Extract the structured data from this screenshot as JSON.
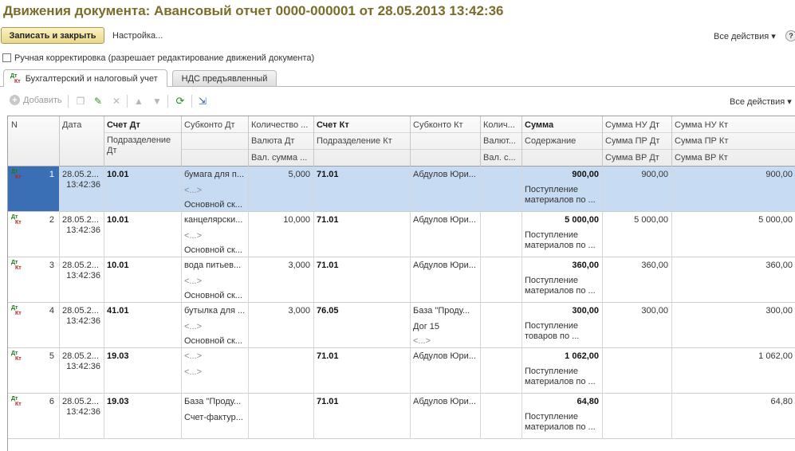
{
  "window": {
    "title": "Движения документа: Авансовый отчет 0000-000001 от 28.05.2013 13:42:36"
  },
  "toolbar": {
    "save_close": "Записать и закрыть",
    "settings": "Настройка...",
    "all_actions": "Все действия ▾",
    "help": "?"
  },
  "manual_correction": {
    "label": "Ручная корректировка (разрешает редактирование движений документа)",
    "checked": false
  },
  "tabs": [
    {
      "icon_top": "Дт",
      "icon_bottom": "Кт",
      "label": "Бухгалтерский и налоговый учет",
      "active": true
    },
    {
      "label": "НДС предъявленный",
      "active": false
    }
  ],
  "table_toolbar": {
    "add": "Добавить",
    "all_actions": "Все действия ▾"
  },
  "table": {
    "headers": {
      "n": "N",
      "date": "Дата",
      "acc_dt": "Счет Дт",
      "sub_dt": "Субконто Дт",
      "qty_dt": "Количество ...",
      "acc_kt": "Счет Кт",
      "sub_kt": "Субконто Кт",
      "qty_kt": "Колич...",
      "sum": "Сумма",
      "sum_nu_dt": "Сумма НУ Дт",
      "sum_nu_kt": "Сумма НУ Кт",
      "dept_dt": "Подразделение Дт",
      "cur_dt": "Валюта Дт",
      "dept_kt": "Подразделение Кт",
      "cur_kt": "Валют...",
      "content": "Содержание",
      "sum_pr_dt": "Сумма ПР Дт",
      "sum_pr_kt": "Сумма ПР Кт",
      "val_sum_dt": "Вал. сумма ...",
      "val_sum_kt": "Вал. с...",
      "sum_vr_dt": "Сумма ВР Дт",
      "sum_vr_kt": "Сумма ВР Кт"
    },
    "rows": [
      {
        "n": "1",
        "date": "28.05.2...",
        "time": "13:42:36",
        "acc_dt": "10.01",
        "sub_dt1": "бумага для п...",
        "sub_dt2": "<...>",
        "sub_dt3": "Основной ск...",
        "qty_dt": "5,000",
        "acc_kt": "71.01",
        "sub_kt1": "Абдулов Юри...",
        "sub_kt2": "",
        "sub_kt3": "",
        "sum": "900,00",
        "content": "Поступление материалов по ...",
        "nu_dt": "900,00",
        "nu_kt": "900,00",
        "selected": true
      },
      {
        "n": "2",
        "date": "28.05.2...",
        "time": "13:42:36",
        "acc_dt": "10.01",
        "sub_dt1": "канцелярски...",
        "sub_dt2": "<...>",
        "sub_dt3": "Основной ск...",
        "qty_dt": "10,000",
        "acc_kt": "71.01",
        "sub_kt1": "Абдулов Юри...",
        "sub_kt2": "",
        "sub_kt3": "",
        "sum": "5 000,00",
        "content": "Поступление материалов по ...",
        "nu_dt": "5 000,00",
        "nu_kt": "5 000,00",
        "selected": false
      },
      {
        "n": "3",
        "date": "28.05.2...",
        "time": "13:42:36",
        "acc_dt": "10.01",
        "sub_dt1": "вода питьев...",
        "sub_dt2": "<...>",
        "sub_dt3": "Основной ск...",
        "qty_dt": "3,000",
        "acc_kt": "71.01",
        "sub_kt1": "Абдулов Юри...",
        "sub_kt2": "",
        "sub_kt3": "",
        "sum": "360,00",
        "content": "Поступление материалов по ...",
        "nu_dt": "360,00",
        "nu_kt": "360,00",
        "selected": false
      },
      {
        "n": "4",
        "date": "28.05.2...",
        "time": "13:42:36",
        "acc_dt": "41.01",
        "sub_dt1": "бутылка для ...",
        "sub_dt2": "<...>",
        "sub_dt3": "Основной ск...",
        "qty_dt": "3,000",
        "acc_kt": "76.05",
        "sub_kt1": "База \"Проду...",
        "sub_kt2": "Дог 15",
        "sub_kt3": "<...>",
        "sum": "300,00",
        "content": "Поступление товаров по ...",
        "nu_dt": "300,00",
        "nu_kt": "300,00",
        "selected": false
      },
      {
        "n": "5",
        "date": "28.05.2...",
        "time": "13:42:36",
        "acc_dt": "19.03",
        "sub_dt1": "<...>",
        "sub_dt2": "<...>",
        "sub_dt3": "",
        "qty_dt": "",
        "acc_kt": "71.01",
        "sub_kt1": "Абдулов Юри...",
        "sub_kt2": "",
        "sub_kt3": "",
        "sum": "1 062,00",
        "content": "Поступление материалов по ...",
        "nu_dt": "",
        "nu_kt": "1 062,00",
        "selected": false
      },
      {
        "n": "6",
        "date": "28.05.2...",
        "time": "13:42:36",
        "acc_dt": "19.03",
        "sub_dt1": "База \"Проду...",
        "sub_dt2": "Счет-фактур...",
        "sub_dt3": "",
        "qty_dt": "",
        "acc_kt": "71.01",
        "sub_kt1": "Абдулов Юри...",
        "sub_kt2": "",
        "sub_kt3": "",
        "sum": "64,80",
        "content": "Поступление материалов по ...",
        "nu_dt": "",
        "nu_kt": "64,80",
        "selected": false
      }
    ]
  }
}
